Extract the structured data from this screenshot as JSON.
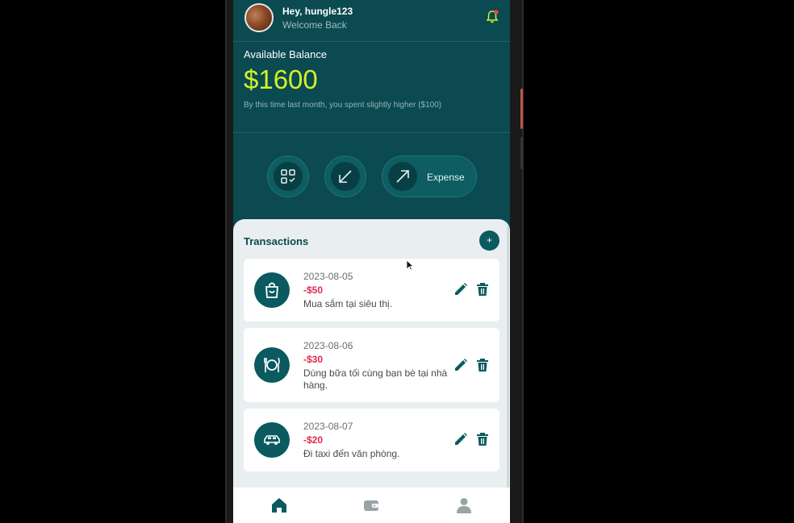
{
  "header": {
    "greeting": "Hey, hungle123",
    "subtitle": "Welcome Back",
    "avatar_icon": "user-avatar-photo",
    "notification_icon": "bell-icon",
    "accent_color": "#d4f02a"
  },
  "balance": {
    "label": "Available Balance",
    "amount": "$1600",
    "note": "By this time last month, you spent slightly higher ($100)"
  },
  "actions": {
    "scan_icon": "qr-scan-icon",
    "income_icon": "arrow-down-left-icon",
    "expense_icon": "arrow-up-right-icon",
    "expense_label": "Expense"
  },
  "transactions": {
    "title": "Transactions",
    "add_label": "+",
    "items": [
      {
        "date": "2023-08-05",
        "amount": "-$50",
        "description": "Mua sắm tại siêu thị.",
        "icon": "shopping-bag-icon"
      },
      {
        "date": "2023-08-06",
        "amount": "-$30",
        "description": "Dùng bữa tối cùng bạn bè tại nhà hàng.",
        "icon": "dining-plate-icon"
      },
      {
        "date": "2023-08-07",
        "amount": "-$20",
        "description": "Đi taxi đến văn phòng.",
        "icon": "taxi-car-icon"
      }
    ],
    "amount_color": "#e0284a"
  },
  "nav": {
    "items": [
      "home-icon",
      "wallet-icon",
      "profile-icon"
    ],
    "active": "home-icon"
  },
  "colors": {
    "primary": "#0a4a50",
    "panel": "#e9eff0"
  }
}
